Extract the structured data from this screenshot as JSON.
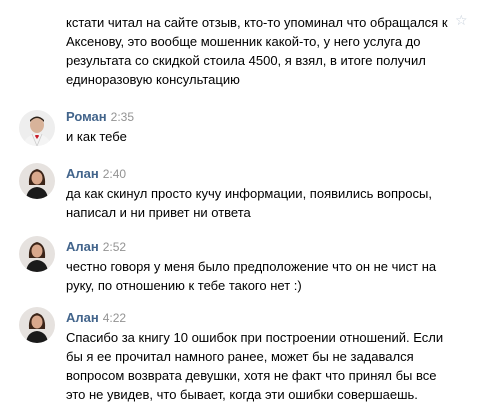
{
  "continued_message": {
    "lines": [
      "кстати читал на сайте отзыв, кто-то упоминал что обращался к",
      "Аксенову, это вообще мошенник какой-то, у него услуга до",
      "результата со скидкой стоила 4500, я взял, в итоге получил",
      "единоразовую консультацию"
    ],
    "star_icon": "☆"
  },
  "messages": [
    {
      "author": "Роман",
      "time": "2:35",
      "avatar_icon": "man-photo",
      "lines": [
        "и как тебе"
      ]
    },
    {
      "author": "Алан",
      "time": "2:40",
      "avatar_icon": "woman-photo",
      "lines": [
        "да как скинул просто кучу информации, появились вопросы,",
        "написал и ни привет ни ответа"
      ]
    },
    {
      "author": "Алан",
      "time": "2:52",
      "avatar_icon": "woman-photo",
      "lines": [
        "честно говоря у меня было предположение что он не чист на",
        "руку, по отношению к тебе такого нет :)"
      ]
    },
    {
      "author": "Алан",
      "time": "4:22",
      "avatar_icon": "woman-photo",
      "lines": [
        "Спасибо за книгу 10 ошибок при построении отношений. Если",
        "бы я ее прочитал намного ранее, может бы не задавался",
        "вопросом возврата девушки, хотя не факт что принял бы все",
        "это не увидев, что бывает, когда эти ошибки совершаешь."
      ]
    }
  ],
  "colors": {
    "author": "#42648b",
    "time": "#939393",
    "text": "#000000",
    "star": "#c6cfda"
  }
}
